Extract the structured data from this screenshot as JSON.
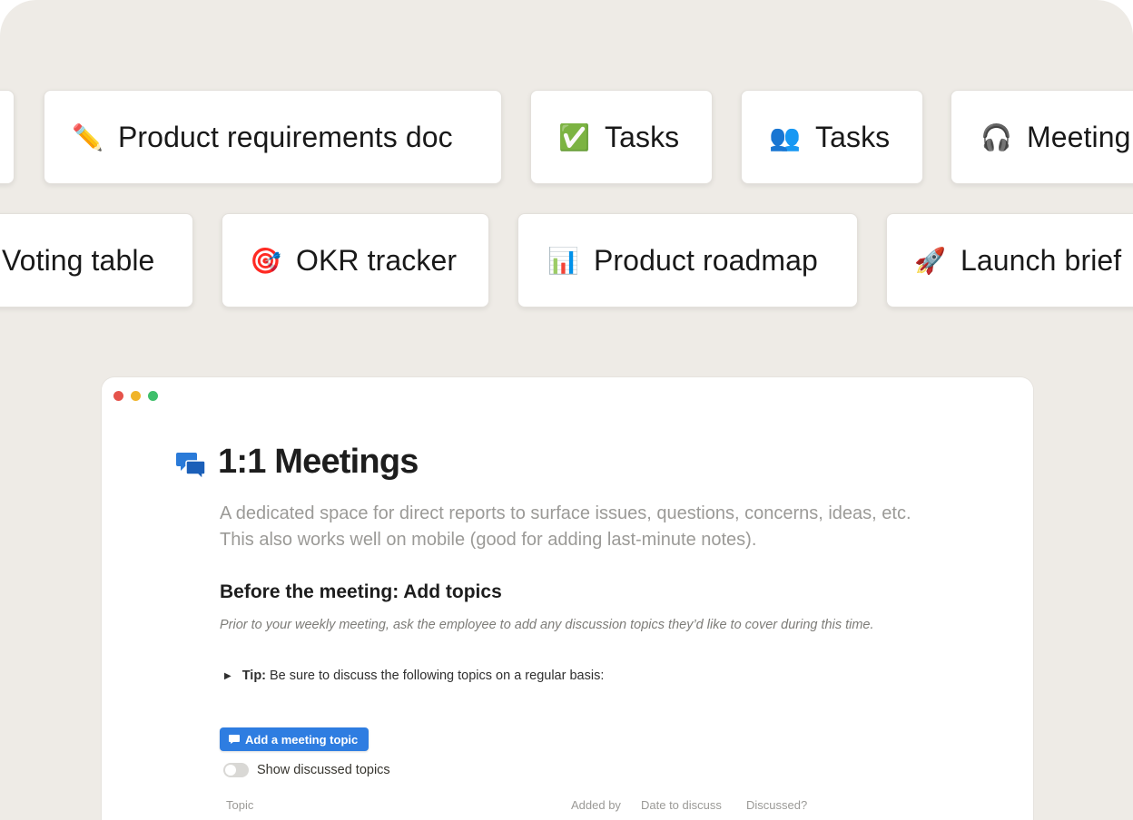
{
  "templates_row1": [
    {
      "icon": "pencil-icon",
      "emoji": "✏️",
      "label": "Product requirements doc"
    },
    {
      "icon": "check-icon",
      "emoji": "✅",
      "label": "Tasks"
    },
    {
      "icon": "people-icon",
      "emoji": "👥",
      "label": "Tasks"
    },
    {
      "icon": "headphones-icon",
      "emoji": "🎧",
      "label": "Meeting"
    }
  ],
  "templates_row2": [
    {
      "label": "Voting table"
    },
    {
      "icon": "target-icon",
      "emoji": "🎯",
      "label": "OKR tracker"
    },
    {
      "icon": "bar-chart-icon",
      "emoji": "📊",
      "label": "Product roadmap"
    },
    {
      "icon": "rocket-icon",
      "emoji": "🚀",
      "label": "Launch brief"
    }
  ],
  "window": {
    "traffic_lights": {
      "close": "#e5534b",
      "minimize": "#f0b429",
      "maximize": "#3fbf6b"
    }
  },
  "doc": {
    "icon": "speech-bubbles-icon",
    "title": "1:1 Meetings",
    "description": "A dedicated space for direct reports to surface issues, questions, concerns, ideas, etc. This also works well on mobile (good for adding last-minute notes).",
    "section_heading": "Before the meeting: Add topics",
    "note": "Prior to your weekly meeting, ask the employee to add any discussion topics they’d like to cover during this time.",
    "tip_label": "Tip:",
    "tip_text": "Be sure to discuss the following topics on a regular basis:",
    "add_button": "Add a meeting topic",
    "toggle_label": "Show discussed topics",
    "toggle_on": false,
    "table_columns": [
      "Topic",
      "Added by",
      "Date to discuss",
      "Discussed?"
    ]
  },
  "colors": {
    "background": "#eeebe6",
    "accent": "#2e7de1"
  }
}
